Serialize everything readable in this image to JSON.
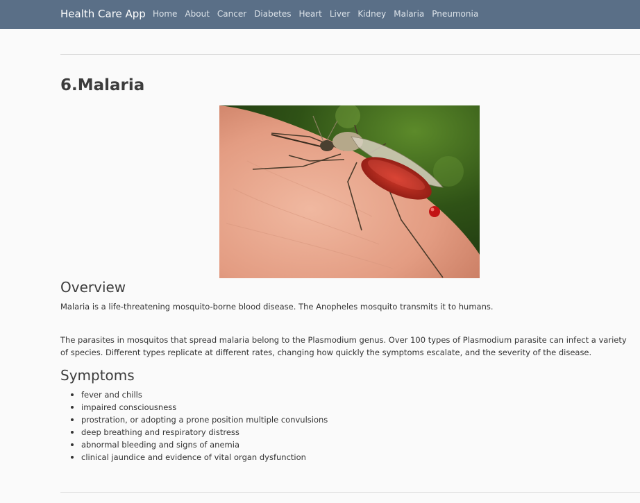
{
  "navbar": {
    "brand": "Health Care App",
    "links": [
      "Home",
      "About",
      "Cancer",
      "Diabetes",
      "Heart",
      "Liver",
      "Kidney",
      "Malaria",
      "Pneumonia"
    ]
  },
  "page": {
    "title": "6.Malaria"
  },
  "overview": {
    "heading": "Overview",
    "paragraphs": [
      "Malaria is a life-threatening mosquito-borne blood disease. The Anopheles mosquito transmits it to humans.",
      "The parasites in mosquitos that spread malaria belong to the Plasmodium genus. Over 100 types of Plasmodium parasite can infect a variety of species. Different types replicate at different rates, changing how quickly the symptoms escalate, and the severity of the disease."
    ]
  },
  "symptoms": {
    "heading": "Symptoms",
    "items": [
      "fever and chills",
      "impaired consciousness",
      "prostration, or adopting a prone position multiple convulsions",
      "deep breathing and respiratory distress",
      "abnormal bleeding and signs of anemia",
      "clinical jaundice and evidence of vital organ dysfunction"
    ]
  }
}
